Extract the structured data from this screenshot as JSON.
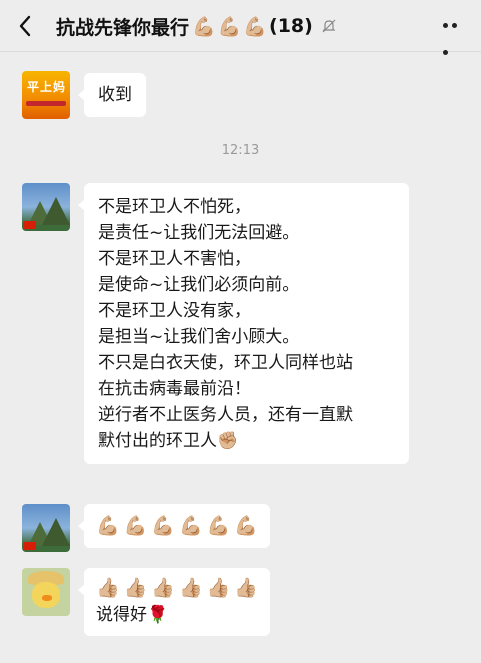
{
  "header": {
    "back_icon": "chevron-left-icon",
    "title": "抗战先锋你最行",
    "title_emojis": [
      "💪🏼",
      "💪🏼",
      "💪🏼"
    ],
    "member_count": "(18)",
    "mute_icon": "mute-bell-icon",
    "more_icon": "more-dots-icon"
  },
  "messages": [
    {
      "avatar": "orange-logo-avatar",
      "avatar_text": "平上妈",
      "text": "收到"
    },
    {
      "avatar": "landscape-avatar",
      "lines": [
        "不是环卫人不怕死，",
        "是责任~让我们无法回避。",
        "不是环卫人不害怕，",
        "是使命~让我们必须向前。",
        "不是环卫人没有家，",
        "是担当~让我们舍小顾大。",
        "不只是白衣天使，环卫人同样也站",
        "在抗击病毒最前沿！",
        "逆行者不止医务人员，还有一直默",
        "默付出的环卫人✊🏼"
      ]
    },
    {
      "avatar": "landscape-avatar",
      "emojis": [
        "💪🏼",
        "💪🏼",
        "💪🏼",
        "💪🏼",
        "💪🏼",
        "💪🏼"
      ]
    },
    {
      "avatar": "duck-hat-avatar",
      "emojis": [
        "👍🏼",
        "👍🏼",
        "👍🏼",
        "👍🏼",
        "👍🏼",
        "👍🏼"
      ],
      "text": "说得好🌹"
    }
  ],
  "timestamp": "12:13"
}
